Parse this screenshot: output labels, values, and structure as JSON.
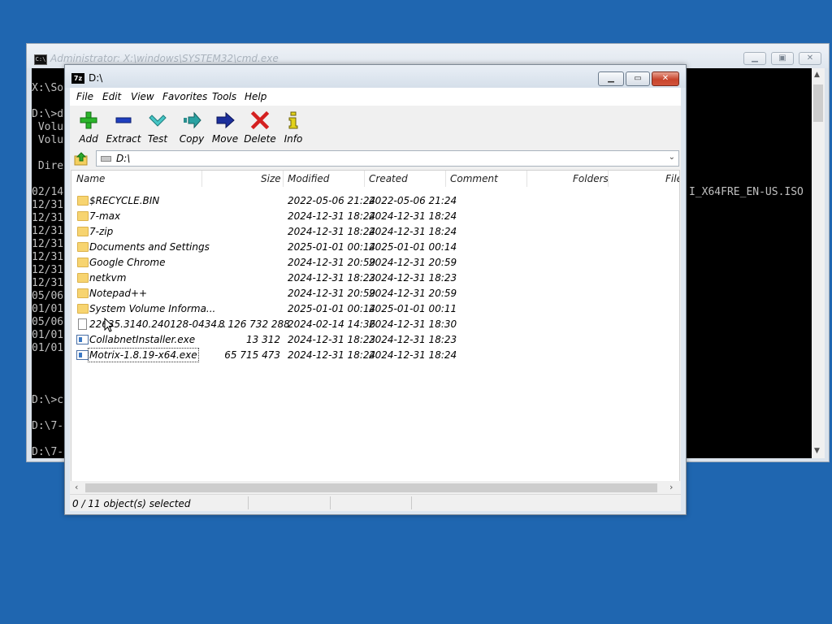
{
  "cmd": {
    "title": "Administrator: X:\\windows\\SYSTEM32\\cmd.exe",
    "lines_left": [
      "X:\\So",
      "D:\\>d",
      " Volu",
      " Volu",
      " Dire",
      "02/14",
      "12/31",
      "12/31",
      "12/31",
      "12/31",
      "12/31",
      "12/31",
      "12/31",
      "05/06",
      "01/01",
      "05/06",
      "01/01",
      "01/01",
      "D:\\>c",
      "D:\\7-",
      "D:\\7-"
    ],
    "line_right": "I_X64FRE_EN-US.ISO"
  },
  "window": {
    "title": "D:\\",
    "logo": "7z"
  },
  "menu": [
    "File",
    "Edit",
    "View",
    "Favorites",
    "Tools",
    "Help"
  ],
  "toolbar": [
    {
      "label": "Add",
      "icon": "add-icon"
    },
    {
      "label": "Extract",
      "icon": "extract-icon"
    },
    {
      "label": "Test",
      "icon": "test-icon"
    },
    {
      "label": "Copy",
      "icon": "copy-icon"
    },
    {
      "label": "Move",
      "icon": "move-icon"
    },
    {
      "label": "Delete",
      "icon": "delete-icon"
    },
    {
      "label": "Info",
      "icon": "info-icon"
    }
  ],
  "address": {
    "path": "D:\\"
  },
  "columns": [
    "Name",
    "Size",
    "Modified",
    "Created",
    "Comment",
    "Folders",
    "File"
  ],
  "files": [
    {
      "name": "$RECYCLE.BIN",
      "size": "",
      "modified": "2022-05-06 21:24",
      "created": "2022-05-06 21:24",
      "type": "folder"
    },
    {
      "name": "7-max",
      "size": "",
      "modified": "2024-12-31 18:24",
      "created": "2024-12-31 18:24",
      "type": "folder"
    },
    {
      "name": "7-zip",
      "size": "",
      "modified": "2024-12-31 18:24",
      "created": "2024-12-31 18:24",
      "type": "folder"
    },
    {
      "name": "Documents and Settings",
      "size": "",
      "modified": "2025-01-01 00:14",
      "created": "2025-01-01 00:14",
      "type": "folder"
    },
    {
      "name": "Google Chrome",
      "size": "",
      "modified": "2024-12-31 20:59",
      "created": "2024-12-31 20:59",
      "type": "folder"
    },
    {
      "name": "netkvm",
      "size": "",
      "modified": "2024-12-31 18:23",
      "created": "2024-12-31 18:23",
      "type": "folder"
    },
    {
      "name": "Notepad++",
      "size": "",
      "modified": "2024-12-31 20:59",
      "created": "2024-12-31 20:59",
      "type": "folder"
    },
    {
      "name": "System Volume Informa...",
      "size": "",
      "modified": "2025-01-01 00:14",
      "created": "2025-01-01 00:11",
      "type": "folder"
    },
    {
      "name": "22635.3140.240128-0434...",
      "size": "8 126 732 288",
      "modified": "2024-02-14 14:36",
      "created": "2024-12-31 18:30",
      "type": "file"
    },
    {
      "name": "CollabnetInstaller.exe",
      "size": "13 312",
      "modified": "2024-12-31 18:23",
      "created": "2024-12-31 18:23",
      "type": "exe"
    },
    {
      "name": "Motrix-1.8.19-x64.exe",
      "size": "65 715 473",
      "modified": "2024-12-31 18:24",
      "created": "2024-12-31 18:24",
      "type": "exe"
    }
  ],
  "status": {
    "text": "0 / 11 object(s) selected"
  },
  "colors": {
    "desktop": "#1f66b0",
    "close_button": "#c8452d",
    "folder": "#f7d470"
  }
}
